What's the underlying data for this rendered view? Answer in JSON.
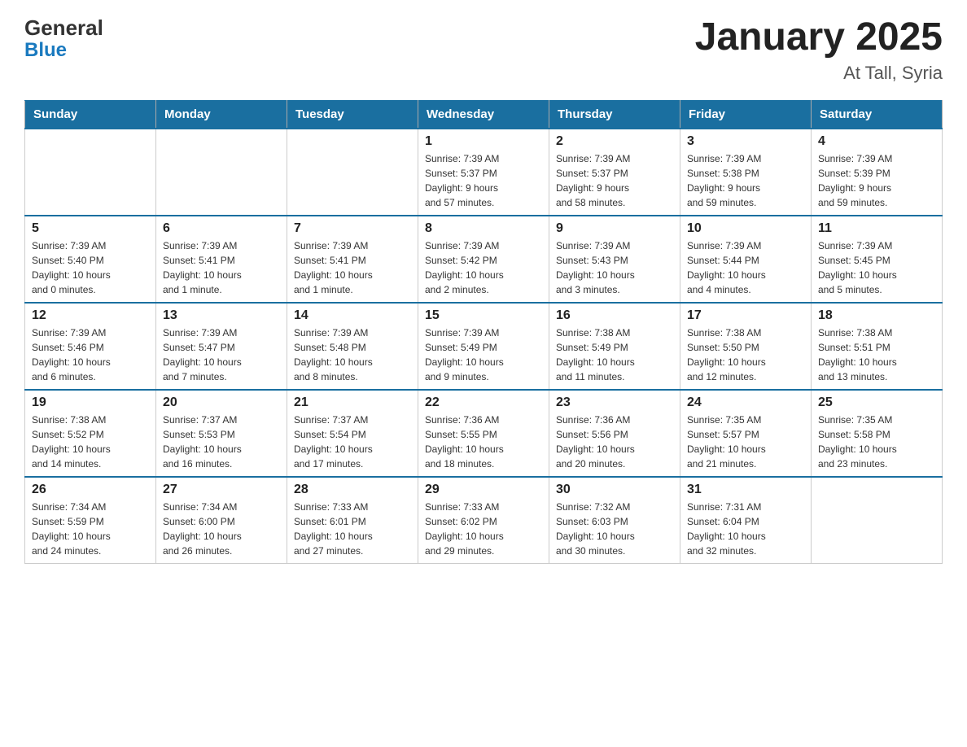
{
  "header": {
    "logo_general": "General",
    "logo_blue": "Blue",
    "month_year": "January 2025",
    "location": "At Tall, Syria"
  },
  "calendar": {
    "days_of_week": [
      "Sunday",
      "Monday",
      "Tuesday",
      "Wednesday",
      "Thursday",
      "Friday",
      "Saturday"
    ],
    "weeks": [
      [
        {
          "day": "",
          "info": ""
        },
        {
          "day": "",
          "info": ""
        },
        {
          "day": "",
          "info": ""
        },
        {
          "day": "1",
          "info": "Sunrise: 7:39 AM\nSunset: 5:37 PM\nDaylight: 9 hours\nand 57 minutes."
        },
        {
          "day": "2",
          "info": "Sunrise: 7:39 AM\nSunset: 5:37 PM\nDaylight: 9 hours\nand 58 minutes."
        },
        {
          "day": "3",
          "info": "Sunrise: 7:39 AM\nSunset: 5:38 PM\nDaylight: 9 hours\nand 59 minutes."
        },
        {
          "day": "4",
          "info": "Sunrise: 7:39 AM\nSunset: 5:39 PM\nDaylight: 9 hours\nand 59 minutes."
        }
      ],
      [
        {
          "day": "5",
          "info": "Sunrise: 7:39 AM\nSunset: 5:40 PM\nDaylight: 10 hours\nand 0 minutes."
        },
        {
          "day": "6",
          "info": "Sunrise: 7:39 AM\nSunset: 5:41 PM\nDaylight: 10 hours\nand 1 minute."
        },
        {
          "day": "7",
          "info": "Sunrise: 7:39 AM\nSunset: 5:41 PM\nDaylight: 10 hours\nand 1 minute."
        },
        {
          "day": "8",
          "info": "Sunrise: 7:39 AM\nSunset: 5:42 PM\nDaylight: 10 hours\nand 2 minutes."
        },
        {
          "day": "9",
          "info": "Sunrise: 7:39 AM\nSunset: 5:43 PM\nDaylight: 10 hours\nand 3 minutes."
        },
        {
          "day": "10",
          "info": "Sunrise: 7:39 AM\nSunset: 5:44 PM\nDaylight: 10 hours\nand 4 minutes."
        },
        {
          "day": "11",
          "info": "Sunrise: 7:39 AM\nSunset: 5:45 PM\nDaylight: 10 hours\nand 5 minutes."
        }
      ],
      [
        {
          "day": "12",
          "info": "Sunrise: 7:39 AM\nSunset: 5:46 PM\nDaylight: 10 hours\nand 6 minutes."
        },
        {
          "day": "13",
          "info": "Sunrise: 7:39 AM\nSunset: 5:47 PM\nDaylight: 10 hours\nand 7 minutes."
        },
        {
          "day": "14",
          "info": "Sunrise: 7:39 AM\nSunset: 5:48 PM\nDaylight: 10 hours\nand 8 minutes."
        },
        {
          "day": "15",
          "info": "Sunrise: 7:39 AM\nSunset: 5:49 PM\nDaylight: 10 hours\nand 9 minutes."
        },
        {
          "day": "16",
          "info": "Sunrise: 7:38 AM\nSunset: 5:49 PM\nDaylight: 10 hours\nand 11 minutes."
        },
        {
          "day": "17",
          "info": "Sunrise: 7:38 AM\nSunset: 5:50 PM\nDaylight: 10 hours\nand 12 minutes."
        },
        {
          "day": "18",
          "info": "Sunrise: 7:38 AM\nSunset: 5:51 PM\nDaylight: 10 hours\nand 13 minutes."
        }
      ],
      [
        {
          "day": "19",
          "info": "Sunrise: 7:38 AM\nSunset: 5:52 PM\nDaylight: 10 hours\nand 14 minutes."
        },
        {
          "day": "20",
          "info": "Sunrise: 7:37 AM\nSunset: 5:53 PM\nDaylight: 10 hours\nand 16 minutes."
        },
        {
          "day": "21",
          "info": "Sunrise: 7:37 AM\nSunset: 5:54 PM\nDaylight: 10 hours\nand 17 minutes."
        },
        {
          "day": "22",
          "info": "Sunrise: 7:36 AM\nSunset: 5:55 PM\nDaylight: 10 hours\nand 18 minutes."
        },
        {
          "day": "23",
          "info": "Sunrise: 7:36 AM\nSunset: 5:56 PM\nDaylight: 10 hours\nand 20 minutes."
        },
        {
          "day": "24",
          "info": "Sunrise: 7:35 AM\nSunset: 5:57 PM\nDaylight: 10 hours\nand 21 minutes."
        },
        {
          "day": "25",
          "info": "Sunrise: 7:35 AM\nSunset: 5:58 PM\nDaylight: 10 hours\nand 23 minutes."
        }
      ],
      [
        {
          "day": "26",
          "info": "Sunrise: 7:34 AM\nSunset: 5:59 PM\nDaylight: 10 hours\nand 24 minutes."
        },
        {
          "day": "27",
          "info": "Sunrise: 7:34 AM\nSunset: 6:00 PM\nDaylight: 10 hours\nand 26 minutes."
        },
        {
          "day": "28",
          "info": "Sunrise: 7:33 AM\nSunset: 6:01 PM\nDaylight: 10 hours\nand 27 minutes."
        },
        {
          "day": "29",
          "info": "Sunrise: 7:33 AM\nSunset: 6:02 PM\nDaylight: 10 hours\nand 29 minutes."
        },
        {
          "day": "30",
          "info": "Sunrise: 7:32 AM\nSunset: 6:03 PM\nDaylight: 10 hours\nand 30 minutes."
        },
        {
          "day": "31",
          "info": "Sunrise: 7:31 AM\nSunset: 6:04 PM\nDaylight: 10 hours\nand 32 minutes."
        },
        {
          "day": "",
          "info": ""
        }
      ]
    ]
  }
}
